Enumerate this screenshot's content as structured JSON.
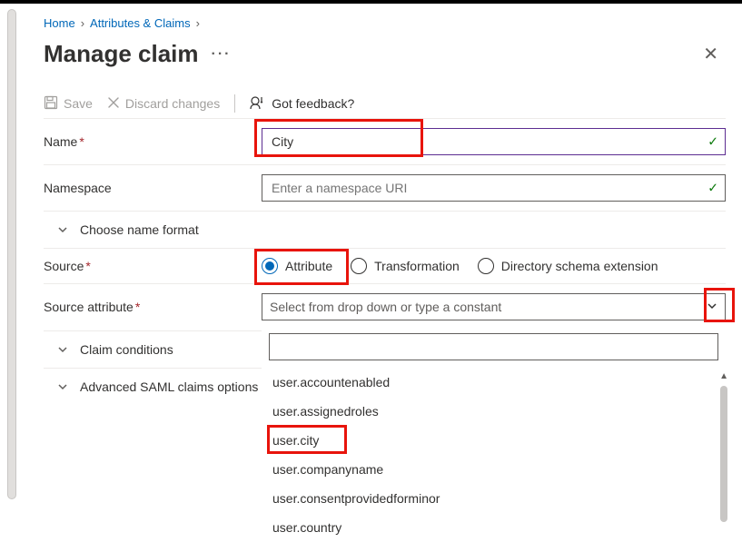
{
  "breadcrumb": {
    "home": "Home",
    "attributes": "Attributes & Claims"
  },
  "title": "Manage claim",
  "toolbar": {
    "save": "Save",
    "discard": "Discard changes",
    "feedback": "Got feedback?"
  },
  "fields": {
    "name_label": "Name",
    "name_value": "City",
    "namespace_label": "Namespace",
    "namespace_placeholder": "Enter a namespace URI",
    "choose_name_format": "Choose name format",
    "source_label": "Source",
    "source_options": {
      "attribute": "Attribute",
      "transformation": "Transformation",
      "directory": "Directory schema extension"
    },
    "source_attribute_label": "Source attribute",
    "source_attribute_placeholder": "Select from drop down or type a constant",
    "claim_conditions": "Claim conditions",
    "advanced_saml": "Advanced SAML claims options"
  },
  "dropdown_items": [
    "user.accountenabled",
    "user.assignedroles",
    "user.city",
    "user.companyname",
    "user.consentprovidedforminor",
    "user.country"
  ]
}
